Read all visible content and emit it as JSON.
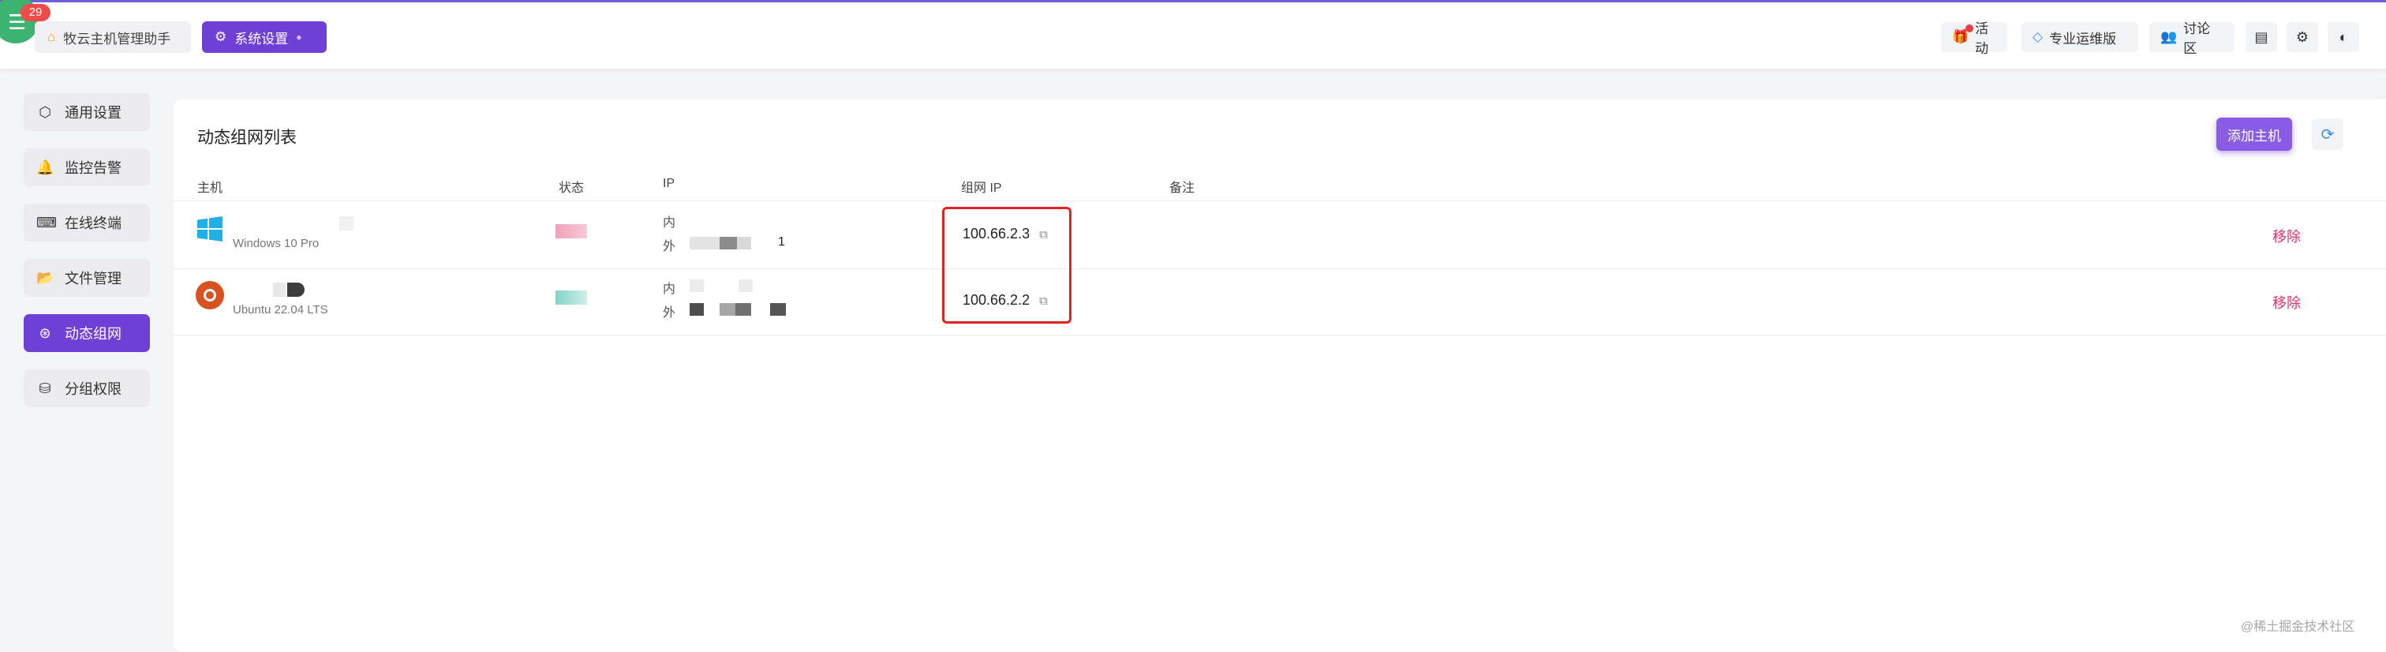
{
  "header": {
    "badge_count": "29",
    "tabs": [
      {
        "label": "牧云主机管理助手",
        "icon": "home-icon"
      },
      {
        "label": "系统设置",
        "icon": "gear-icon"
      }
    ],
    "buttons": [
      {
        "label": "活动",
        "icon": "gift-icon"
      },
      {
        "label": "专业运维版",
        "icon": "diamond-icon"
      },
      {
        "label": "讨论区",
        "icon": "users-icon"
      }
    ],
    "icon_buttons": [
      "document-icon",
      "settings-icon",
      "theme-toggle-icon"
    ]
  },
  "sidebar": {
    "items": [
      {
        "label": "通用设置",
        "icon": "settings-hex-icon"
      },
      {
        "label": "监控告警",
        "icon": "bell-icon"
      },
      {
        "label": "在线终端",
        "icon": "terminal-icon"
      },
      {
        "label": "文件管理",
        "icon": "folder-icon"
      },
      {
        "label": "动态组网",
        "icon": "network-icon",
        "active": true
      },
      {
        "label": "分组权限",
        "icon": "group-permission-icon"
      }
    ]
  },
  "panel": {
    "title": "动态组网列表",
    "add_button": "添加主机",
    "refresh_icon": "refresh-icon",
    "columns": [
      "主机",
      "状态",
      "IP",
      "组网 IP",
      "备注"
    ],
    "rows": [
      {
        "os": "Windows 10 Pro",
        "os_icon": "windows-icon",
        "ip_inner_label": "内",
        "ip_outer_label": "外",
        "ip_outer_tail": "1",
        "network_ip": "100.66.2.3",
        "remark": "",
        "action": "移除"
      },
      {
        "os": "Ubuntu 22.04 LTS",
        "os_icon": "ubuntu-icon",
        "ip_inner_label": "内",
        "ip_outer_label": "外",
        "ip_outer_tail": "",
        "network_ip": "100.66.2.2",
        "remark": "",
        "action": "移除"
      }
    ]
  },
  "watermark": "@稀土掘金技术社区",
  "colors": {
    "accent": "#6f3fd6",
    "danger": "#e4306a",
    "highlight": "#e02222"
  }
}
